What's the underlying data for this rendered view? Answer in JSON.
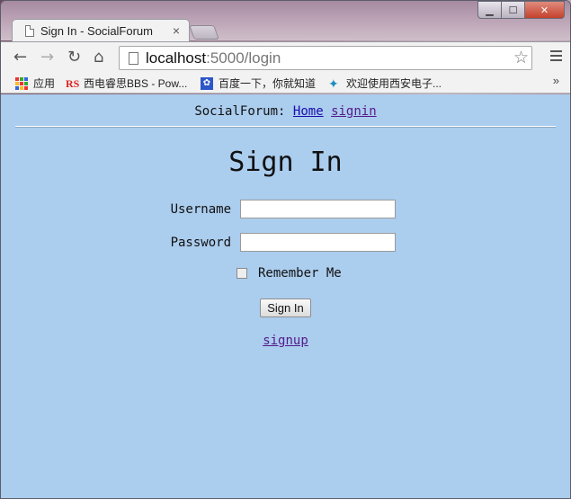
{
  "browser": {
    "tab_title": "Sign In - SocialForum",
    "url_host": "localhost",
    "url_rest": ":5000/login",
    "window_controls": {
      "minimize": "▁",
      "maximize": "☐",
      "close": "✕"
    },
    "icons": {
      "back": "arrow-left-icon",
      "forward": "arrow-right-icon",
      "reload": "reload-icon",
      "home": "home-icon",
      "star": "star-icon",
      "menu": "hamburger-menu-icon"
    },
    "bookmarks_more": "»",
    "bookmarks": [
      {
        "label": "应用"
      },
      {
        "label": "西电睿思BBS - Pow..."
      },
      {
        "label": "百度一下，你就知道"
      },
      {
        "label": "欢迎使用西安电子..."
      }
    ]
  },
  "page": {
    "site_name": "SocialForum:",
    "nav_home": "Home",
    "nav_signin": "signin",
    "heading": "Sign In",
    "username_label": "Username",
    "username_value": "",
    "password_label": "Password",
    "password_value": "",
    "remember_label": "Remember Me",
    "submit_label": "Sign In",
    "signup_link": "signup"
  },
  "colors": {
    "page_background": "#abcdee",
    "link": "#1a0dab",
    "visited_link": "#551a8b"
  }
}
